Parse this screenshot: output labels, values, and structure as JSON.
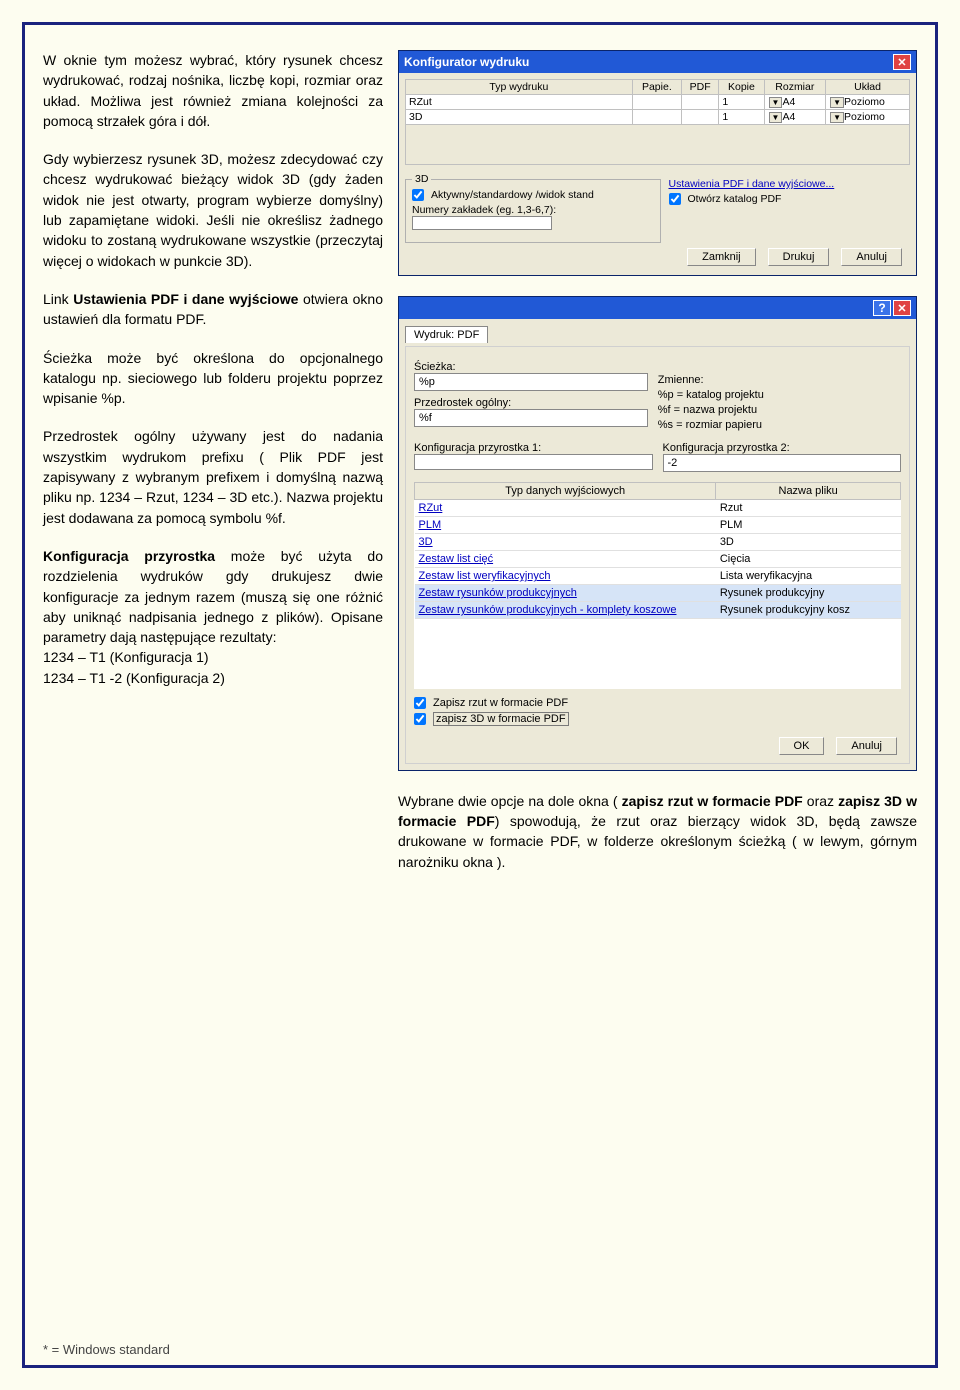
{
  "left": {
    "p1": "W oknie tym możesz wybrać, który rysunek chcesz wydrukować, rodzaj nośnika, liczbę kopi, rozmiar oraz układ. Możliwa jest również zmiana kolejności za pomocą strzałek góra i dół.",
    "p2": "Gdy wybierzesz rysunek 3D, możesz zdecydować czy chcesz wydrukować bieżący widok 3D (gdy żaden widok nie jest otwarty, program wybierze domyślny) lub zapamiętane widoki. Jeśli nie określisz żadnego widoku to zostaną wydrukowane wszystkie (przeczytaj więcej o widokach w punkcie 3D).",
    "p3a": "Link ",
    "p3b": "Ustawienia PDF i dane wyjściowe",
    "p3c": " otwiera okno ustawień dla formatu PDF.",
    "p4": "Ścieżka może być określona do opcjonalnego katalogu np. sieciowego lub folderu projektu poprzez wpisanie %p.",
    "p5": "Przedrostek ogólny używany jest do nadania wszystkim wydrukom prefixu ( Plik PDF jest zapisywany z wybranym prefixem  i domyślną nazwą pliku np. 1234 – Rzut, 1234 – 3D etc.). Nazwa projektu jest dodawana za pomocą symbolu %f.",
    "p6a": "Konfiguracja przyrostka",
    "p6b": " może być użyta do rozdzielenia wydruków gdy drukujesz dwie konfiguracje za jednym razem (muszą się one różnić aby uniknąć nadpisania jednego z plików). Opisane parametry dają następujące rezultaty:",
    "p6c": "1234 – T1 (Konfiguracja 1)",
    "p6d": "1234 – T1 -2 (Konfiguracja 2)"
  },
  "win1": {
    "title": "Konfigurator wydruku",
    "cols": {
      "typ": "Typ wydruku",
      "papie": "Papie.",
      "pdf": "PDF",
      "kopie": "Kopie",
      "rozmiar": "Rozmiar",
      "uklad": "Układ"
    },
    "rows": [
      {
        "typ": "RZut",
        "papie": "",
        "pdf": "",
        "kopie": "1",
        "rozmiar": "A4",
        "uklad": "Poziomo"
      },
      {
        "typ": "3D",
        "papie": "",
        "pdf": "",
        "kopie": "1",
        "rozmiar": "A4",
        "uklad": "Poziomo"
      }
    ],
    "group3d": "3D",
    "chk_active": "Aktywny/standardowy /widok stand",
    "bookmarks": "Numery zakładek (eg. 1,3-6,7):",
    "link_pdf": "Ustawienia PDF i dane wyjściowe...",
    "chk_open": "Otwórz katalog PDF",
    "btn_close": "Zamknij",
    "btn_print": "Drukuj",
    "btn_cancel": "Anuluj"
  },
  "win2": {
    "tab": "Wydruk: PDF",
    "path_lbl": "Ścieżka:",
    "path_val": "%p",
    "vars_lbl": "Zmienne:",
    "vars1": "%p = katalog projektu",
    "vars2": "%f = nazwa projektu",
    "vars3": "%s = rozmiar papieru",
    "prefix_lbl": "Przedrostek ogólny:",
    "prefix_val": "%f",
    "suf1_lbl": "Konfiguracja przyrostka 1:",
    "suf1_val": "",
    "suf2_lbl": "Konfiguracja przyrostka 2:",
    "suf2_val": "-2",
    "col_type": "Typ danych wyjściowych",
    "col_name": "Nazwa pliku",
    "rows": [
      {
        "t": "RZut",
        "n": "Rzut"
      },
      {
        "t": "PLM",
        "n": "PLM"
      },
      {
        "t": "3D",
        "n": "3D"
      },
      {
        "t": "Zestaw list cięć",
        "n": "Cięcia"
      },
      {
        "t": "Zestaw list weryfikacyjnych",
        "n": "Lista weryfikacyjna"
      },
      {
        "t": "Zestaw rysunków produkcyjnych",
        "n": "Rysunek produkcyjny"
      },
      {
        "t": "Zestaw rysunków produkcyjnych - komplety koszowe",
        "n": "Rysunek produkcyjny kosz"
      }
    ],
    "chk1": "Zapisz rzut w formacie PDF",
    "chk2": "zapisz 3D w formacie PDF",
    "ok": "OK",
    "cancel": "Anuluj"
  },
  "right_text": {
    "a": "Wybrane dwie opcje na dole okna ( ",
    "b": "zapisz rzut w formacie PDF",
    "c": "   oraz ",
    "d": "zapisz 3D w formacie PDF",
    "e": ") spowodują, że rzut  oraz bierzący widok 3D, będą zawsze drukowane  w formacie PDF, w folderze określonym ścieżką ( w lewym, górnym narożniku okna )."
  },
  "footnote": "* = Windows standard"
}
